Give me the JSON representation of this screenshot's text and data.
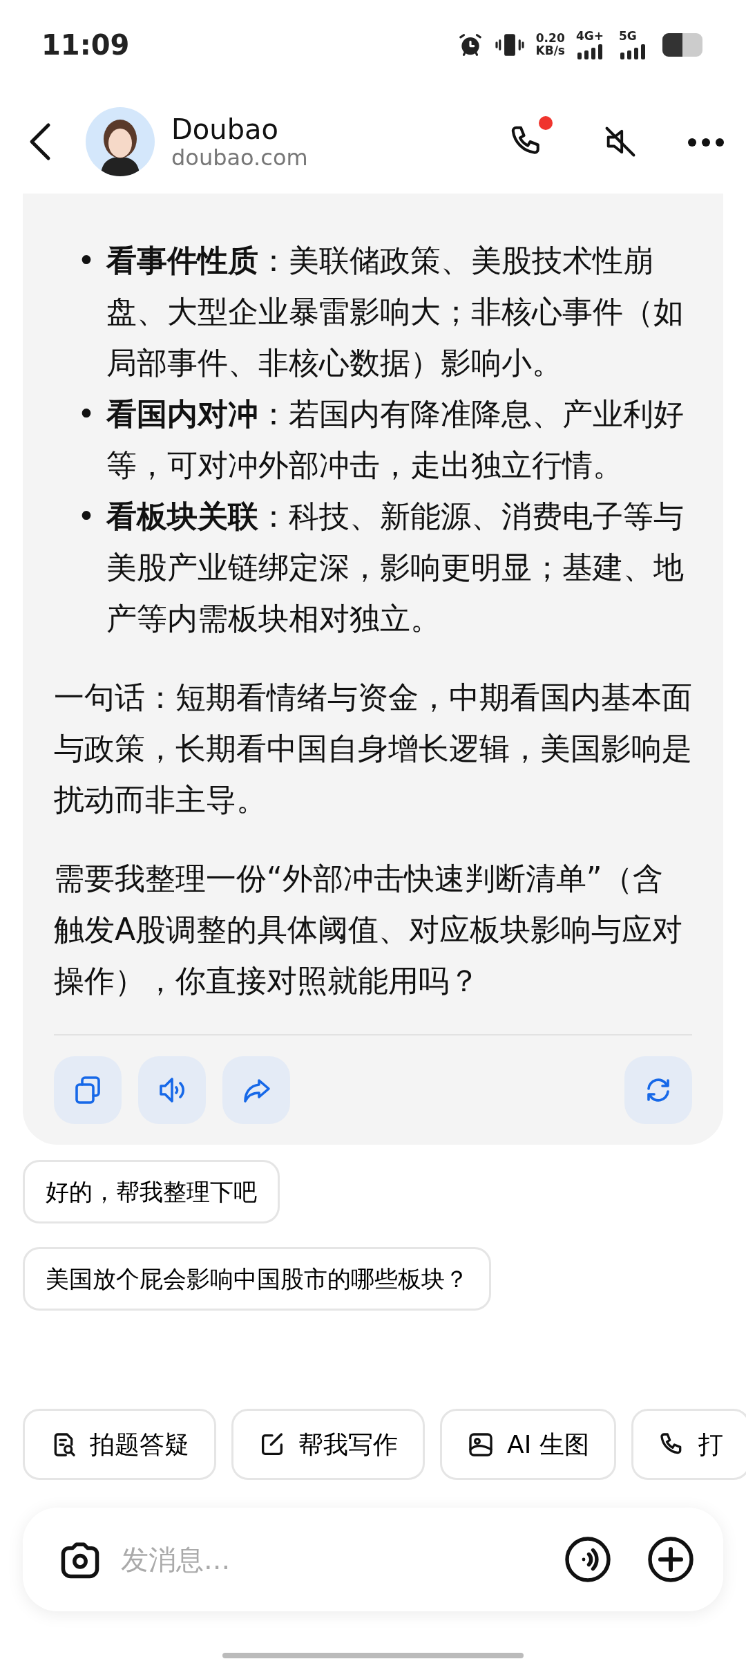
{
  "status_bar": {
    "time": "11:09",
    "net_speed": "0.20",
    "net_unit": "KB/s",
    "sim_1": "4G+",
    "sim_2": "5G"
  },
  "header": {
    "title": "Doubao",
    "subtitle": "doubao.com",
    "call_notification": true
  },
  "message": {
    "bullets": [
      {
        "marker": "•",
        "text": "**看事件性质**：美联储政策、美股技术性崩盘、大型企业暴雷影响大；非核心事件（如局部事件、非核心数据）影响小。"
      },
      {
        "marker": "•",
        "text": "**看国内对冲**：若国内有降准降息、产业利好等，可对冲外部冲击，走出独立行情。"
      },
      {
        "marker": "•",
        "text": "**看板块关联**：科技、新能源、消费电子等与美股产业链绑定深，影响更明显；基建、地产等内需板块相对独立。"
      }
    ],
    "paragraphs": [
      "一句话：短期看情绪与资金，中期看国内基本面与政策，长期看中国自身增长逻辑，美国影响是扰动而非主导。",
      "需要我整理一份“外部冲击快速判断清单”（含触发A股调整的具体阈值、对应板块影响与应对操作），你直接对照就能用吗？"
    ],
    "actions": [
      {
        "kind": "copy"
      },
      {
        "kind": "speak"
      },
      {
        "kind": "share"
      },
      {
        "kind": "regenerate"
      }
    ]
  },
  "suggestions": [
    "好的，帮我整理下吧",
    "美国放个屁会影响中国股市的哪些板块？"
  ],
  "tools": [
    {
      "kind": "photo-search",
      "label": "拍题答疑"
    },
    {
      "kind": "write",
      "label": "帮我写作"
    },
    {
      "kind": "image",
      "label": "AI 生图"
    },
    {
      "kind": "call",
      "label": "打"
    }
  ],
  "input": {
    "placeholder": "发消息..."
  }
}
